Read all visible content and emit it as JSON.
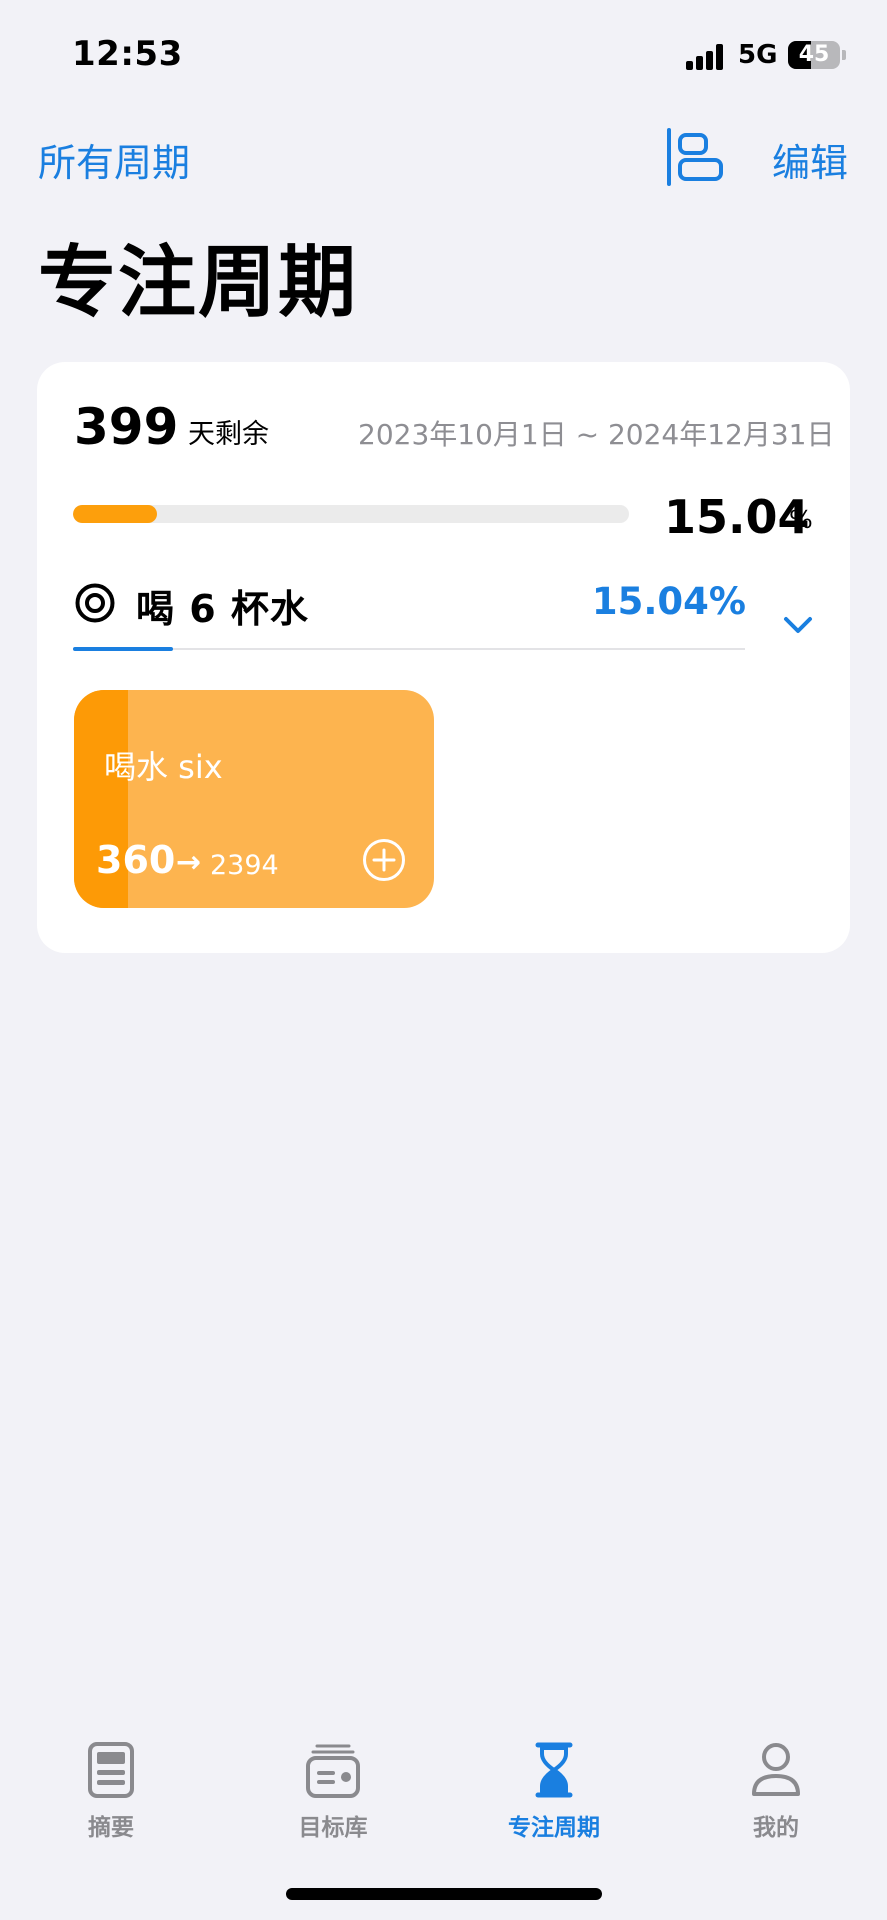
{
  "status_bar": {
    "time": "12:53",
    "network": "5G",
    "battery_level": "45",
    "battery_fraction": 0.45
  },
  "nav": {
    "back_label": "所有周期",
    "layout_icon": "sidebar-layout-icon",
    "edit_label": "编辑"
  },
  "page_title": "专注周期",
  "cycle": {
    "days_remaining": "399",
    "days_label": "天剩余",
    "date_range": "2023年10月1日 ~ 2024年12月31日",
    "progress_percent_value": "15.04",
    "progress_percent_sign": "%",
    "progress_fraction": 0.1504
  },
  "goal": {
    "icon": "target-icon",
    "name": "喝 6 杯水",
    "percent": "15.04%",
    "chevron_icon": "chevron-down-icon"
  },
  "habit": {
    "name": "喝水 six",
    "current": "360",
    "arrow": "→",
    "target": "2394",
    "progress_fraction": 0.15,
    "add_icon": "plus-circle-icon",
    "colors": {
      "fill": "#fd9a06",
      "background": "#fdb44f"
    }
  },
  "tab_bar": {
    "items": [
      {
        "label": "摘要",
        "icon": "summary-icon",
        "active": false
      },
      {
        "label": "目标库",
        "icon": "goal-library-icon",
        "active": false
      },
      {
        "label": "专注周期",
        "icon": "hourglass-icon",
        "active": true
      },
      {
        "label": "我的",
        "icon": "person-icon",
        "active": false
      }
    ]
  },
  "colors": {
    "accent": "#1a7fe0",
    "progress": "#fd9f0c",
    "background": "#f2f2f7",
    "tab_inactive": "#8a8a8e"
  }
}
